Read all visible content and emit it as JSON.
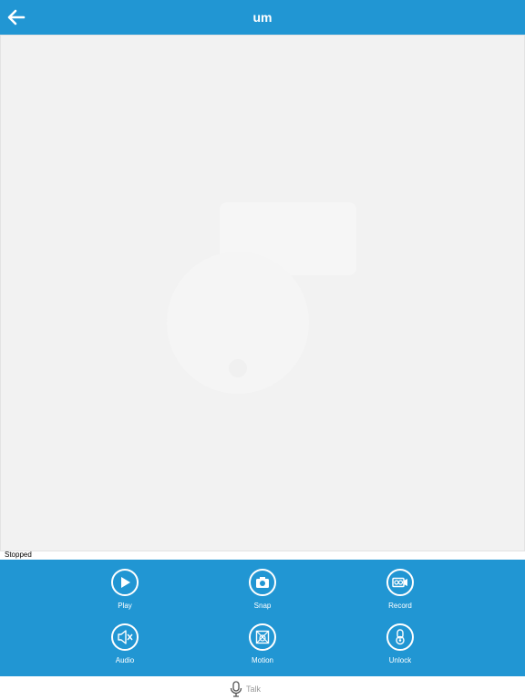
{
  "header": {
    "title": "um",
    "back_icon": "arrow-left-icon"
  },
  "status": {
    "text": "Stopped"
  },
  "controls": [
    {
      "label": "Play",
      "icon": "play-icon"
    },
    {
      "label": "Snap",
      "icon": "camera-icon"
    },
    {
      "label": "Record",
      "icon": "record-icon"
    },
    {
      "label": "Audio",
      "icon": "speaker-muted-icon"
    },
    {
      "label": "Motion",
      "icon": "motion-icon"
    },
    {
      "label": "Unlock",
      "icon": "unlock-icon"
    }
  ],
  "talk": {
    "label": "Talk",
    "icon": "microphone-icon"
  },
  "colors": {
    "accent": "#2196d3",
    "video_bg": "#f2f2f2"
  }
}
